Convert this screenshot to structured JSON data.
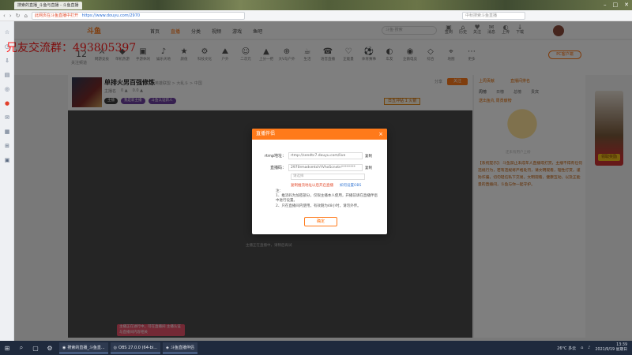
{
  "browser": {
    "tabs": [
      "搜索的直播_斗鱼与直播 - 斗鱼直播"
    ],
    "url": "https://www.douyu.com/2970",
    "url_warning": "此网页在斗鱼直播中打开",
    "search_placeholder": "中秋搜索斗鱼直播"
  },
  "watermark": "兄友交流群：493805397",
  "site": {
    "logo": "斗鱼",
    "nav": [
      "首页",
      "直播",
      "分类",
      "视频",
      "游戏",
      "鱼吧"
    ],
    "search_placeholder": "斗鱼·搜索",
    "nav_icons": [
      {
        "icon": "▣",
        "label": "签到"
      },
      {
        "icon": "⌂",
        "label": "历史"
      },
      {
        "icon": "♥",
        "label": "关注"
      },
      {
        "icon": "✉",
        "label": "消息"
      },
      {
        "icon": "◐",
        "label": "上传"
      },
      {
        "icon": "↓",
        "label": "下载"
      }
    ]
  },
  "category_strip": {
    "follow_count": "12",
    "follow_label": "关注频道",
    "categories": [
      "网游竞技",
      "单机热游",
      "手游休闲",
      "娱乐天地",
      "颜值",
      "科技文化",
      "户外",
      "二次元",
      "上分一把",
      "大V与户外",
      "生活",
      "语音直播",
      "正能量",
      "体育赛事",
      "车友",
      "企鹅电竞",
      "综合",
      "地图",
      "更多"
    ],
    "pc_button": "PC客户端"
  },
  "room": {
    "title": "单排火男百强修炼",
    "category": "英雄联盟 > 大乱斗 > 中国",
    "meta": [
      "主播名",
      "0 ▲",
      "0.0 ▲"
    ],
    "tags": [
      "主播",
      "我是新主播",
      "斗鱼认证新人"
    ],
    "rank": "日五冲钻 1 火箭",
    "actions": [
      "分享",
      "关注"
    ],
    "follow_btn": "关注"
  },
  "player": {
    "status_text": "主播正在直播中，请稍后再试"
  },
  "bottom_warning": "主播正在进行中，可在直播间 主播认证与直播间内容相关",
  "right_panel": {
    "top": [
      "上周贡献",
      "直播间排名"
    ],
    "tabs": [
      "周榜",
      "日榜",
      "总榜",
      "贵宾"
    ],
    "rank_label": "送出鱼丸 周贡献榜",
    "empty": "还未有用户上榜",
    "notice": "【系统提示】：斗鱼禁止未成年人直播或打赏，主播不得有任何违规行为，若有违规将严格处罚，请文明观看，理性打赏，谨防诈骗，切勿轻信私下交易。文明观看，健康互动，以及正能量的直播间，斗鱼与你一起守护。"
  },
  "ad": {
    "label": "领取奖励"
  },
  "dialog": {
    "title": "直播伴侣",
    "rtmp_label": "rtmp地址：",
    "rtmp_value": "rtmp://sendtc7.douyu.com/live",
    "key_label": "直播码：",
    "key_value": "2970rmadsmtchYVhxScnxtn********",
    "copy": "复制",
    "select_placeholder": "请选择",
    "link_red": "复制推流地址以后开启直播",
    "link_blue": "如何设置OBS",
    "notes": [
      "注：",
      "1、推流码为加密部分，仅限主播本人使用，开播前请在直播伴侣中进行设置。",
      "2、只在直播间内使用，有效期为48小时，请勿外传。"
    ],
    "ok": "确定"
  },
  "taskbar": {
    "apps": [
      "搜索的直播_斗鱼直...",
      "OBS 27.0.0 (64-bi...",
      "斗鱼直播伴侣"
    ],
    "weather": "26°C 多云",
    "clock_time": "13:39",
    "clock_date": "2021/9/19 星期日"
  }
}
